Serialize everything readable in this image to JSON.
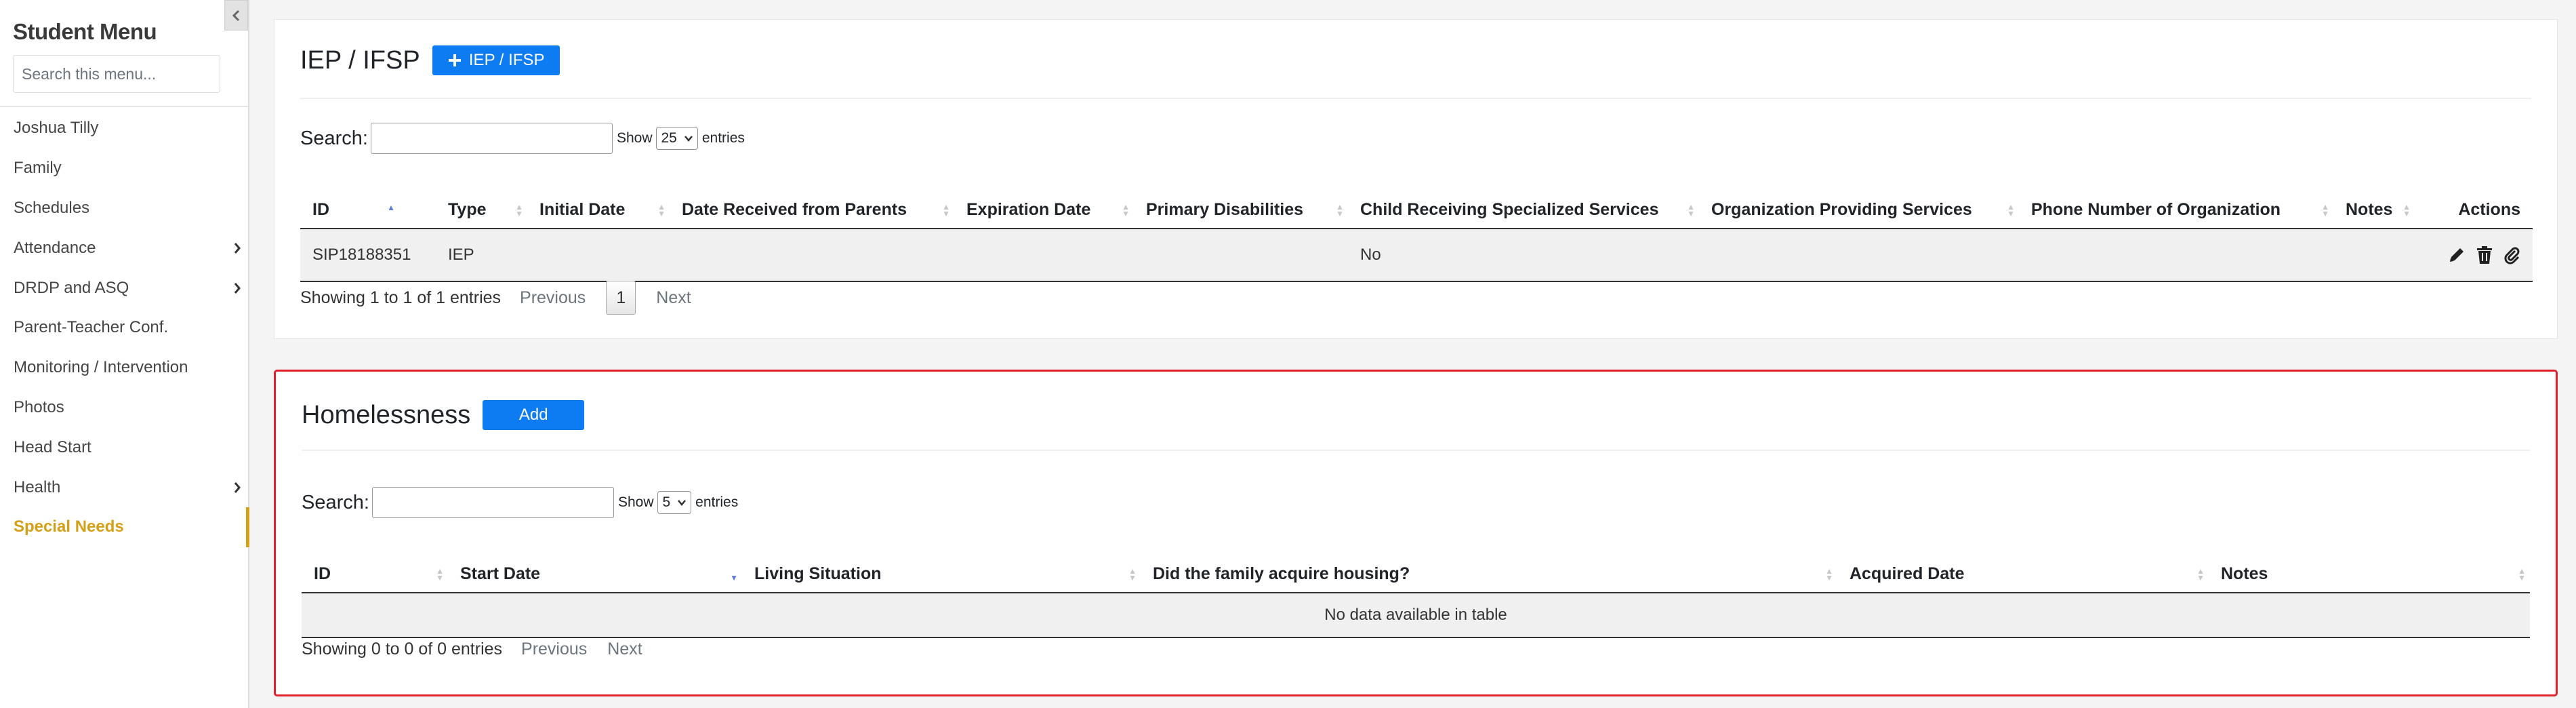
{
  "sidebar": {
    "title": "Student Menu",
    "search_placeholder": "Search this menu...",
    "items": [
      {
        "label": "Joshua Tilly"
      },
      {
        "label": "Family"
      },
      {
        "label": "Schedules"
      },
      {
        "label": "Attendance"
      },
      {
        "label": "DRDP and ASQ"
      },
      {
        "label": "Parent-Teacher Conf."
      },
      {
        "label": "Monitoring / Intervention"
      },
      {
        "label": "Photos"
      },
      {
        "label": "Head Start"
      },
      {
        "label": "Health"
      },
      {
        "label": "Special Needs"
      }
    ]
  },
  "iep": {
    "title": "IEP / IFSP",
    "add_label": "IEP / IFSP",
    "search_label": "Search:",
    "show_label": "Show",
    "show_value": "25",
    "entries_label": "entries",
    "columns": [
      "ID",
      "Type",
      "Initial Date",
      "Date Received from Parents",
      "Expiration Date",
      "Primary Disabilities",
      "Child Receiving Specialized Services",
      "Organization Providing Services",
      "Phone Number of Organization",
      "Notes",
      "Actions"
    ],
    "rows": [
      {
        "id": "SIP18188351",
        "type": "IEP",
        "initial_date": "",
        "date_received": "",
        "expiration": "",
        "primary_disabilities": "",
        "receiving": "No",
        "org": "",
        "phone": "",
        "notes": ""
      }
    ],
    "info": "Showing 1 to 1 of 1 entries",
    "prev": "Previous",
    "page": "1",
    "next": "Next"
  },
  "homeless": {
    "title": "Homelessness",
    "add_label": "Add",
    "search_label": "Search:",
    "show_label": "Show",
    "show_value": "5",
    "entries_label": "entries",
    "columns": [
      "ID",
      "Start Date",
      "Living Situation",
      "Did the family acquire housing?",
      "Acquired Date",
      "Notes"
    ],
    "empty": "No data available in table",
    "info": "Showing 0 to 0 of 0 entries",
    "prev": "Previous",
    "next": "Next"
  },
  "colors": {
    "primary": "#0d7bf2",
    "active": "#d4a017",
    "highlight": "#e0202c"
  }
}
